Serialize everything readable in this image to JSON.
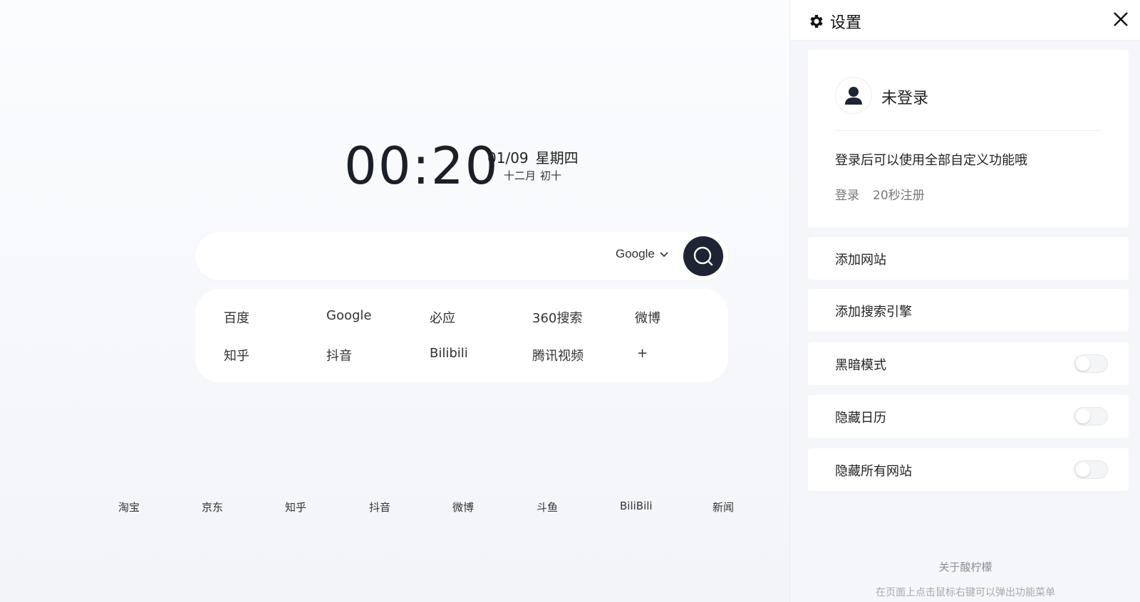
{
  "clock": {
    "time": "00:20",
    "date": "01/09",
    "weekday": "星期四",
    "lunar_month": "十二月",
    "lunar_day": "初十"
  },
  "search": {
    "placeholder": "",
    "engine": "Google"
  },
  "shortcuts": [
    {
      "label": "百度"
    },
    {
      "label": "Google"
    },
    {
      "label": "必应"
    },
    {
      "label": "360搜索"
    },
    {
      "label": "微博"
    },
    {
      "label": "知乎"
    },
    {
      "label": "抖音"
    },
    {
      "label": "Bilibili"
    },
    {
      "label": "腾讯视频"
    },
    {
      "label": "+"
    }
  ],
  "bottom_links": [
    {
      "label": "淘宝"
    },
    {
      "label": "京东"
    },
    {
      "label": "知乎"
    },
    {
      "label": "抖音"
    },
    {
      "label": "微博"
    },
    {
      "label": "斗鱼"
    },
    {
      "label": "BiliBili"
    },
    {
      "label": "新闻"
    }
  ],
  "settings": {
    "title": "设置",
    "user": {
      "name": "未登录",
      "hint": "登录后可以使用全部自定义功能哦",
      "login": "登录",
      "register": "20秒注册"
    },
    "rows": [
      {
        "label": "添加网站"
      },
      {
        "label": "添加搜索引擎"
      },
      {
        "label": "黑暗模式",
        "toggle": false
      },
      {
        "label": "隐藏日历",
        "toggle": false
      },
      {
        "label": "隐藏所有网站",
        "toggle": false
      }
    ],
    "about": "关于酸柠檬",
    "tip": "在页面上点击鼠标右键可以弹出功能菜单"
  },
  "icons": {
    "settings": "gear-icon",
    "close": "close-icon",
    "search": "search-icon",
    "user": "user-icon",
    "dropdown": "chevron-down-icon"
  },
  "colors": {
    "search_button": "#1d2433",
    "panel_bg": "#f5f6f9"
  }
}
